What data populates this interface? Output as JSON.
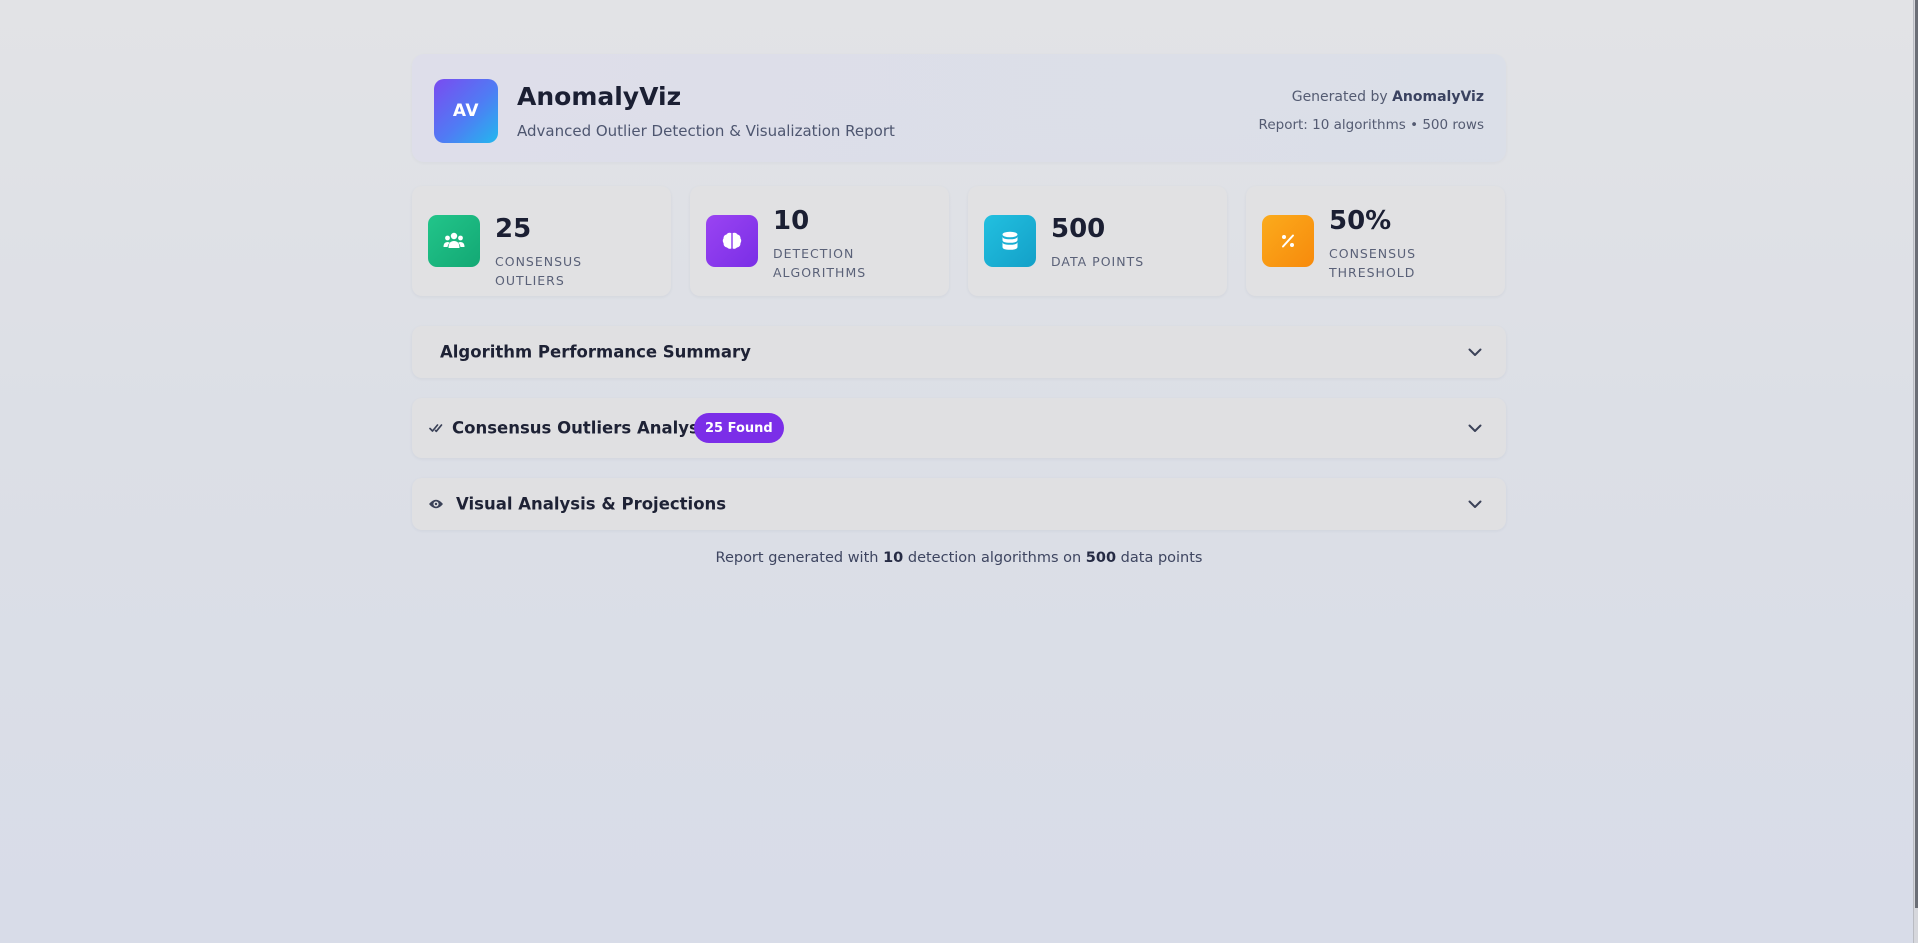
{
  "header": {
    "logo_text": "AV",
    "title": "AnomalyViz",
    "subtitle": "Advanced Outlier Detection & Visualization Report",
    "generated_prefix": "Generated by ",
    "generated_by": "AnomalyViz",
    "report_line": "Report: 10 algorithms • 500 rows"
  },
  "stats": [
    {
      "value": "25",
      "label": "CONSENSUS OUTLIERS",
      "icon": "users-icon",
      "color": "#22c58a"
    },
    {
      "value": "10",
      "label": "DETECTION ALGORITHMS",
      "icon": "brain-icon",
      "color": "#8b3cf0"
    },
    {
      "value": "500",
      "label": "DATA POINTS",
      "icon": "database-icon",
      "color": "#22b5d8"
    },
    {
      "value": "50%",
      "label": "CONSENSUS THRESHOLD",
      "icon": "percent-icon",
      "color": "#f9a010"
    }
  ],
  "panels": {
    "performance": {
      "title": "Algorithm Performance Summary"
    },
    "consensus": {
      "title": "Consensus Outliers Analysis",
      "badge": "25 Found",
      "icon": "double-check-icon"
    },
    "visual": {
      "title": "Visual Analysis & Projections",
      "icon": "eye-icon"
    }
  },
  "footer": {
    "part1": "Report generated with ",
    "algorithms": "10",
    "part2": " detection algorithms on ",
    "points": "500",
    "part3": " data points"
  }
}
